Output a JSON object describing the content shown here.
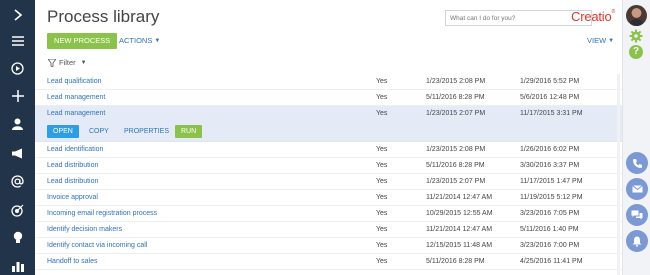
{
  "header": {
    "title": "Process library",
    "search_placeholder": "What can I do for you?",
    "logo": "Creatio",
    "logo_mark": "®"
  },
  "toolbar": {
    "new_process": "NEW PROCESS",
    "actions": "ACTIONS",
    "view": "VIEW",
    "filter": "Filter"
  },
  "rows_top": [
    {
      "name": "Lead qualification",
      "active": "Yes",
      "created": "1/23/2015 2:08 PM",
      "modified": "1/29/2016 5:52 PM"
    },
    {
      "name": "Lead management",
      "active": "Yes",
      "created": "5/11/2016 8:28 PM",
      "modified": "5/6/2016 12:48 PM"
    }
  ],
  "selected_row": {
    "name": "Lead management",
    "active": "Yes",
    "created": "1/23/2015 2:07 PM",
    "modified": "11/17/2015 3:31 PM"
  },
  "row_actions": {
    "open": "OPEN",
    "copy": "COPY",
    "properties": "PROPERTIES",
    "run": "RUN"
  },
  "rows_bottom": [
    {
      "name": "Lead identification",
      "active": "Yes",
      "created": "1/23/2015 2:08 PM",
      "modified": "1/26/2016 6:02 PM"
    },
    {
      "name": "Lead distribution",
      "active": "Yes",
      "created": "5/11/2016 8:28 PM",
      "modified": "3/30/2016 3:37 PM"
    },
    {
      "name": "Lead distribution",
      "active": "Yes",
      "created": "1/23/2015 2:07 PM",
      "modified": "11/17/2015 1:47 PM"
    },
    {
      "name": "Invoice approval",
      "active": "Yes",
      "created": "11/21/2014 12:47 AM",
      "modified": "11/19/2015 5:12 PM"
    },
    {
      "name": "Incoming email registration process",
      "active": "Yes",
      "created": "10/29/2015 12:55 AM",
      "modified": "3/23/2016 7:05 PM"
    },
    {
      "name": "Identify decision makers",
      "active": "Yes",
      "created": "11/21/2014 12:47 AM",
      "modified": "5/11/2016 1:40 PM"
    },
    {
      "name": "Identify contact via incoming call",
      "active": "Yes",
      "created": "12/15/2015 11:48 AM",
      "modified": "3/23/2016 7:00 PM"
    },
    {
      "name": "Handoff to sales",
      "active": "Yes",
      "created": "5/11/2016 8:28 PM",
      "modified": "4/25/2016 11:41 PM"
    }
  ],
  "colors": {
    "nav": "#22344a",
    "accent_green": "#8bc34a",
    "accent_blue": "#2d9de6",
    "link": "#2d73b8",
    "selected": "#e4ebf6",
    "logo": "#e0362c"
  }
}
